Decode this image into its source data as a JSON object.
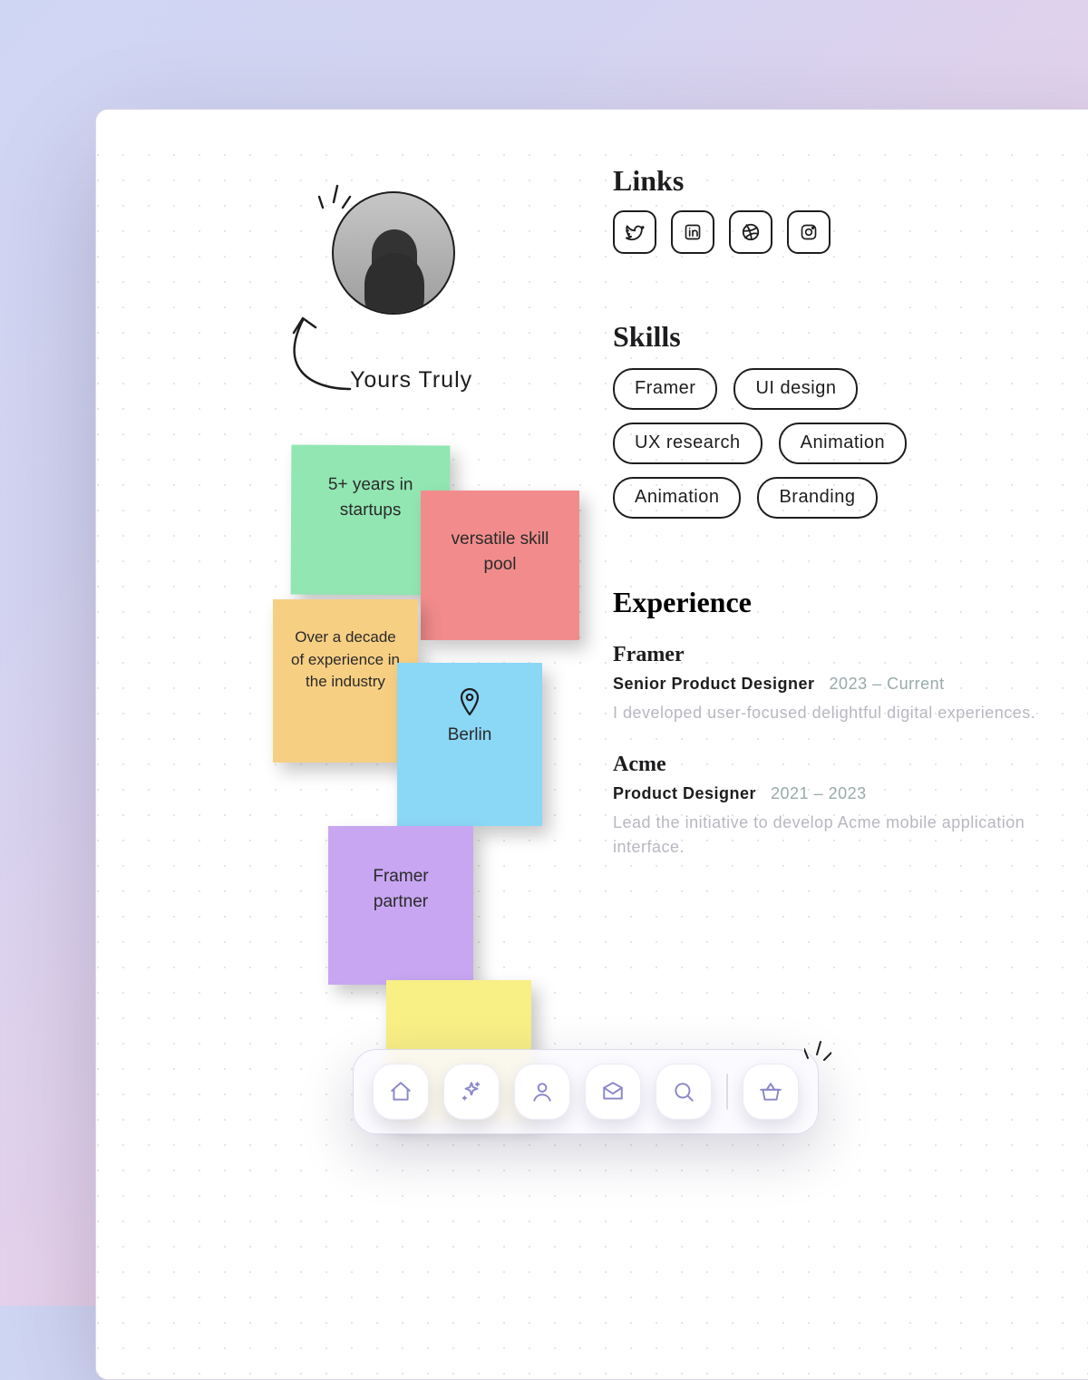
{
  "profile": {
    "name_label": "Yours Truly"
  },
  "stickies": {
    "green": "5+ years in startups",
    "red": "versatile skill pool",
    "orange": "Over a decade of experience in the industry",
    "blue": "Berlin",
    "purple": "Framer partner",
    "yellow": ""
  },
  "links": {
    "heading": "Links",
    "items": [
      "twitter",
      "linkedin",
      "dribbble",
      "instagram"
    ]
  },
  "skills": {
    "heading": "Skills",
    "items": [
      "Framer",
      "UI design",
      "UX research",
      "Animation",
      "Animation",
      "Branding"
    ]
  },
  "experience": {
    "heading": "Experience",
    "jobs": [
      {
        "company": "Framer",
        "role": "Senior Product Designer",
        "dates": "2023 – Current",
        "desc": "I developed user-focused delightful digital experiences."
      },
      {
        "company": "Acme",
        "role": "Product Designer",
        "dates": "2021 – 2023",
        "desc": "Lead the initiative to develop Acme mobile application interface."
      }
    ]
  },
  "toolbar": {
    "items": [
      "home",
      "sparkle",
      "profile",
      "mail",
      "search",
      "basket"
    ]
  }
}
